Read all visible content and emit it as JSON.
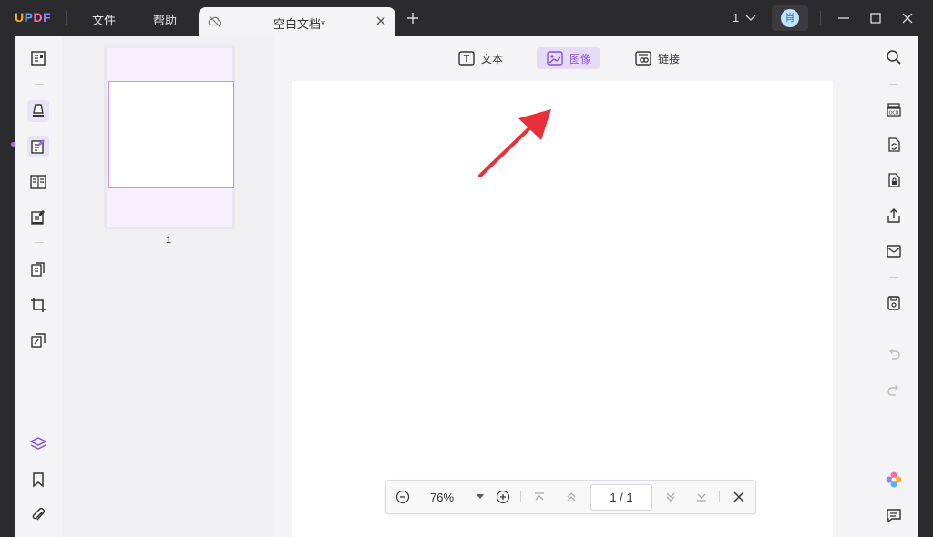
{
  "app": {
    "logo_text": "UPDF",
    "menu": [
      "文件",
      "帮助"
    ],
    "tab_title": "空白文档*",
    "page_count": "1",
    "avatar_initial": "肖"
  },
  "toolbar": {
    "text_label": "文本",
    "image_label": "图像",
    "link_label": "链接"
  },
  "thumbnails": {
    "page_number": "1"
  },
  "zoom": {
    "value": "76%",
    "page_indicator": "1 / 1"
  },
  "colors": {
    "accent": "#a674e8",
    "active_tool_bg": "#e6dcf8",
    "annotation_arrow": "#e8303a"
  },
  "icons": {
    "left_rail": [
      "reader-icon",
      "highlighter-icon",
      "edit-pdf-icon",
      "form-icon",
      "fill-sign-icon",
      "organize-pages-icon",
      "crop-icon",
      "compare-icon",
      "layers-icon",
      "bookmark-icon",
      "attachment-icon"
    ],
    "right_rail": [
      "search-icon",
      "ocr-icon",
      "convert-icon",
      "protect-icon",
      "share-icon",
      "email-icon",
      "save-icon",
      "undo-icon",
      "redo-icon",
      "ai-assistant-icon",
      "comment-icon"
    ]
  }
}
